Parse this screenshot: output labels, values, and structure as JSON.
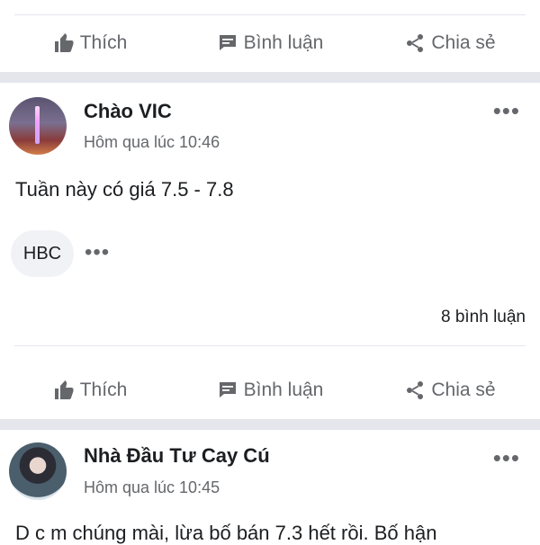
{
  "actions": {
    "like_label": "Thích",
    "comment_label": "Bình luận",
    "share_label": "Chia sẻ"
  },
  "posts": [
    {
      "author": "Chào VIC",
      "time": "Hôm qua lúc 10:46",
      "text": "Tuần này có giá  7.5 - 7.8",
      "reply_chip": "HBC",
      "comment_count": "8 bình luận"
    },
    {
      "author": "Nhà Đầu Tư Cay Cú",
      "time": "Hôm qua lúc 10:45",
      "text": "D c m chúng mài, lừa bố bán 7.3 hết rồi. Bố hận"
    }
  ],
  "colors": {
    "secondary_text": "#65676b",
    "separator": "#e4e6eb",
    "chip_bg": "#f0f2f5"
  },
  "icons": [
    "thumbs-up-icon",
    "comment-icon",
    "share-icon",
    "more-options-icon"
  ]
}
